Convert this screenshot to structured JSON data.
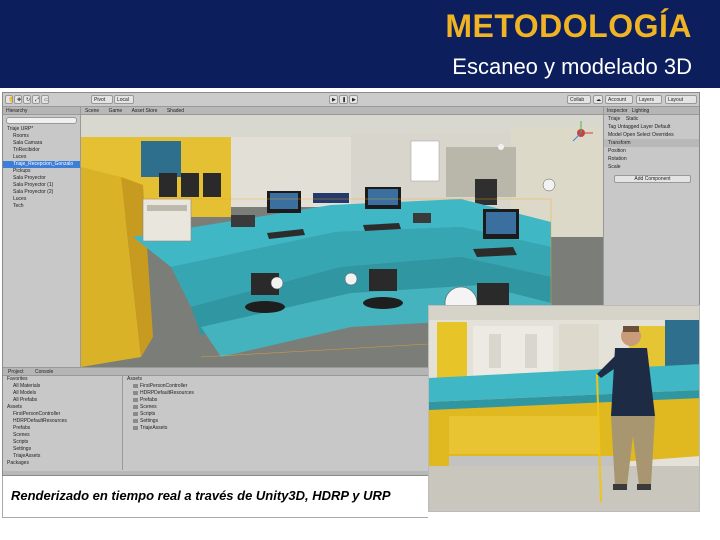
{
  "slide": {
    "title": "METODOLOGÍA",
    "subtitle": "Escaneo y modelado 3D",
    "caption": "Renderizado en tiempo real a través de Unity3D, HDRP y URP"
  },
  "colors": {
    "header_bg": "#0c1f5c",
    "title": "#f0b324",
    "subtitle": "#ffffff",
    "counter_teal": "#3fb7c4",
    "wall_yellow": "#e8c21a"
  },
  "editor": {
    "toolbar": {
      "pivot_label": "Pivot",
      "local_label": "Local",
      "collab_label": "Collab",
      "account_label": "Account",
      "layers_label": "Layers",
      "layout_label": "Layout"
    },
    "hierarchy": {
      "tab": "Hierarchy",
      "items": [
        "Triaje URP*",
        "Rooms",
        "Sala Camara",
        "TriRecibidor",
        "Luces",
        "Triaje_Recepcion_Gonzalo",
        "Pickups",
        "Sala Proyector",
        "Sala Proyector (1)",
        "Sala Proyector (2)",
        "Luces",
        "Tech"
      ]
    },
    "scene_tabs": [
      "Scene",
      "Game",
      "Asset Store"
    ],
    "scene_mode": "Shaded",
    "inspector": {
      "tab": "Inspector",
      "lighting_tab": "Lighting",
      "object_name": "Triaje",
      "static_label": "Static",
      "tag_label": "Tag",
      "tag_value": "Untagged",
      "layer_label": "Layer",
      "layer_value": "Default",
      "model_label": "Model",
      "open_label": "Open",
      "select_label": "Select",
      "overrides_label": "Overrides",
      "transform_label": "Transform",
      "position_label": "Position",
      "rotation_label": "Rotation",
      "scale_label": "Scale",
      "add_component_label": "Add Component"
    },
    "project": {
      "tabs": [
        "Project",
        "Console"
      ],
      "favorites_label": "Favorites",
      "favorites": [
        "All Materials",
        "All Models",
        "All Prefabs"
      ],
      "assets_label": "Assets",
      "asset_tree": [
        "FirstPersonController",
        "HDRPDefaultResources",
        "Prefabs",
        "Scenes",
        "Scripts",
        "Settings",
        "TriajeAssets"
      ],
      "packages_label": "Packages",
      "assets_header": "Assets",
      "asset_folders": [
        "FirstPersonController",
        "HDRPDefaultResources",
        "Prefabs",
        "Scenes",
        "Scripts",
        "Settings",
        "TriajeAssets"
      ]
    }
  }
}
